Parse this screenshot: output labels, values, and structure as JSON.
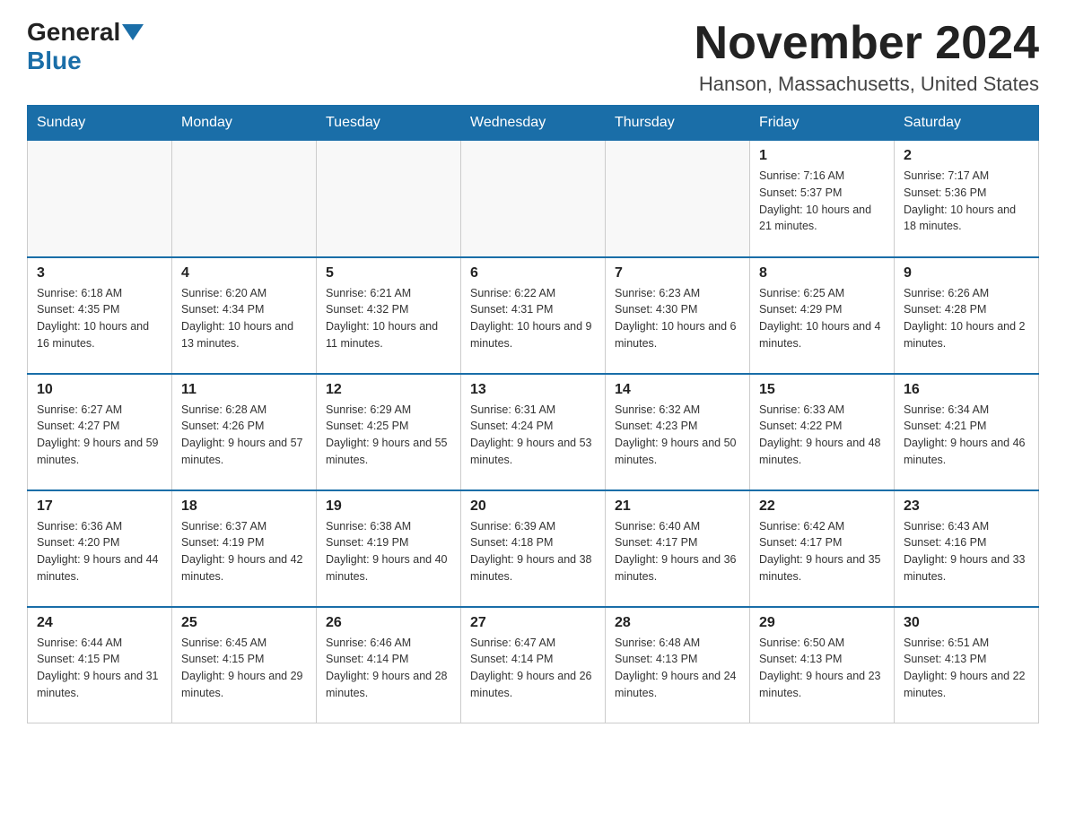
{
  "logo": {
    "general": "General",
    "blue": "Blue"
  },
  "header": {
    "title": "November 2024",
    "location": "Hanson, Massachusetts, United States"
  },
  "days_of_week": [
    "Sunday",
    "Monday",
    "Tuesday",
    "Wednesday",
    "Thursday",
    "Friday",
    "Saturday"
  ],
  "weeks": [
    [
      {
        "day": "",
        "info": ""
      },
      {
        "day": "",
        "info": ""
      },
      {
        "day": "",
        "info": ""
      },
      {
        "day": "",
        "info": ""
      },
      {
        "day": "",
        "info": ""
      },
      {
        "day": "1",
        "info": "Sunrise: 7:16 AM\nSunset: 5:37 PM\nDaylight: 10 hours and 21 minutes."
      },
      {
        "day": "2",
        "info": "Sunrise: 7:17 AM\nSunset: 5:36 PM\nDaylight: 10 hours and 18 minutes."
      }
    ],
    [
      {
        "day": "3",
        "info": "Sunrise: 6:18 AM\nSunset: 4:35 PM\nDaylight: 10 hours and 16 minutes."
      },
      {
        "day": "4",
        "info": "Sunrise: 6:20 AM\nSunset: 4:34 PM\nDaylight: 10 hours and 13 minutes."
      },
      {
        "day": "5",
        "info": "Sunrise: 6:21 AM\nSunset: 4:32 PM\nDaylight: 10 hours and 11 minutes."
      },
      {
        "day": "6",
        "info": "Sunrise: 6:22 AM\nSunset: 4:31 PM\nDaylight: 10 hours and 9 minutes."
      },
      {
        "day": "7",
        "info": "Sunrise: 6:23 AM\nSunset: 4:30 PM\nDaylight: 10 hours and 6 minutes."
      },
      {
        "day": "8",
        "info": "Sunrise: 6:25 AM\nSunset: 4:29 PM\nDaylight: 10 hours and 4 minutes."
      },
      {
        "day": "9",
        "info": "Sunrise: 6:26 AM\nSunset: 4:28 PM\nDaylight: 10 hours and 2 minutes."
      }
    ],
    [
      {
        "day": "10",
        "info": "Sunrise: 6:27 AM\nSunset: 4:27 PM\nDaylight: 9 hours and 59 minutes."
      },
      {
        "day": "11",
        "info": "Sunrise: 6:28 AM\nSunset: 4:26 PM\nDaylight: 9 hours and 57 minutes."
      },
      {
        "day": "12",
        "info": "Sunrise: 6:29 AM\nSunset: 4:25 PM\nDaylight: 9 hours and 55 minutes."
      },
      {
        "day": "13",
        "info": "Sunrise: 6:31 AM\nSunset: 4:24 PM\nDaylight: 9 hours and 53 minutes."
      },
      {
        "day": "14",
        "info": "Sunrise: 6:32 AM\nSunset: 4:23 PM\nDaylight: 9 hours and 50 minutes."
      },
      {
        "day": "15",
        "info": "Sunrise: 6:33 AM\nSunset: 4:22 PM\nDaylight: 9 hours and 48 minutes."
      },
      {
        "day": "16",
        "info": "Sunrise: 6:34 AM\nSunset: 4:21 PM\nDaylight: 9 hours and 46 minutes."
      }
    ],
    [
      {
        "day": "17",
        "info": "Sunrise: 6:36 AM\nSunset: 4:20 PM\nDaylight: 9 hours and 44 minutes."
      },
      {
        "day": "18",
        "info": "Sunrise: 6:37 AM\nSunset: 4:19 PM\nDaylight: 9 hours and 42 minutes."
      },
      {
        "day": "19",
        "info": "Sunrise: 6:38 AM\nSunset: 4:19 PM\nDaylight: 9 hours and 40 minutes."
      },
      {
        "day": "20",
        "info": "Sunrise: 6:39 AM\nSunset: 4:18 PM\nDaylight: 9 hours and 38 minutes."
      },
      {
        "day": "21",
        "info": "Sunrise: 6:40 AM\nSunset: 4:17 PM\nDaylight: 9 hours and 36 minutes."
      },
      {
        "day": "22",
        "info": "Sunrise: 6:42 AM\nSunset: 4:17 PM\nDaylight: 9 hours and 35 minutes."
      },
      {
        "day": "23",
        "info": "Sunrise: 6:43 AM\nSunset: 4:16 PM\nDaylight: 9 hours and 33 minutes."
      }
    ],
    [
      {
        "day": "24",
        "info": "Sunrise: 6:44 AM\nSunset: 4:15 PM\nDaylight: 9 hours and 31 minutes."
      },
      {
        "day": "25",
        "info": "Sunrise: 6:45 AM\nSunset: 4:15 PM\nDaylight: 9 hours and 29 minutes."
      },
      {
        "day": "26",
        "info": "Sunrise: 6:46 AM\nSunset: 4:14 PM\nDaylight: 9 hours and 28 minutes."
      },
      {
        "day": "27",
        "info": "Sunrise: 6:47 AM\nSunset: 4:14 PM\nDaylight: 9 hours and 26 minutes."
      },
      {
        "day": "28",
        "info": "Sunrise: 6:48 AM\nSunset: 4:13 PM\nDaylight: 9 hours and 24 minutes."
      },
      {
        "day": "29",
        "info": "Sunrise: 6:50 AM\nSunset: 4:13 PM\nDaylight: 9 hours and 23 minutes."
      },
      {
        "day": "30",
        "info": "Sunrise: 6:51 AM\nSunset: 4:13 PM\nDaylight: 9 hours and 22 minutes."
      }
    ]
  ]
}
